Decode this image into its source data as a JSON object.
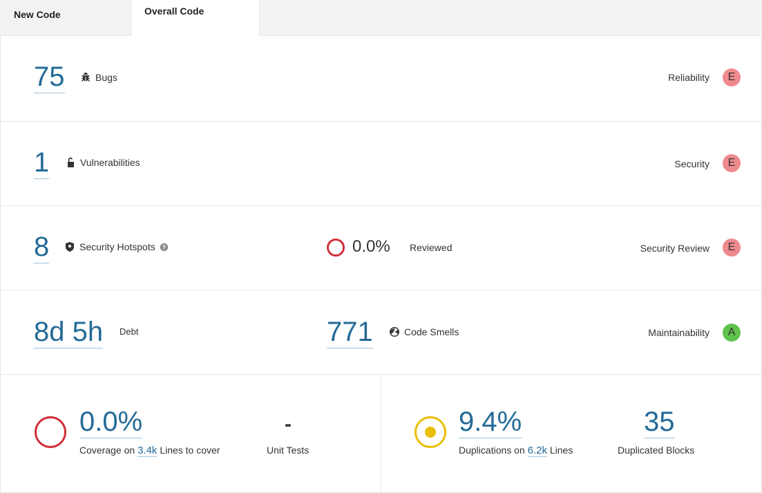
{
  "tabs": {
    "new_code": "New Code",
    "overall_code": "Overall Code"
  },
  "reliability": {
    "value": "75",
    "label": "Bugs",
    "rating_label": "Reliability",
    "rating": "E"
  },
  "security": {
    "value": "1",
    "label": "Vulnerabilities",
    "rating_label": "Security",
    "rating": "E"
  },
  "hotspots": {
    "value": "8",
    "label": "Security Hotspots",
    "reviewed_pct": "0.0%",
    "reviewed_label": "Reviewed",
    "rating_label": "Security Review",
    "rating": "E"
  },
  "maintainability": {
    "debt_value": "8d 5h",
    "debt_label": "Debt",
    "smells_value": "771",
    "smells_label": "Code Smells",
    "rating_label": "Maintainability",
    "rating": "A"
  },
  "coverage": {
    "value": "0.0%",
    "prefix": "Coverage on",
    "lines": "3.4k",
    "suffix": "Lines to cover",
    "unit_tests_value": "-",
    "unit_tests_label": "Unit Tests"
  },
  "duplications": {
    "value": "9.4%",
    "prefix": "Duplications on",
    "lines": "6.2k",
    "suffix": "Lines",
    "blocks_value": "35",
    "blocks_label": "Duplicated Blocks"
  },
  "colors": {
    "link": "#236a97",
    "rating_e": "#ee8a8e",
    "rating_a": "#5fc24d",
    "coverage_ring": "#d02f3a",
    "duplication_ring": "#eabe06"
  }
}
